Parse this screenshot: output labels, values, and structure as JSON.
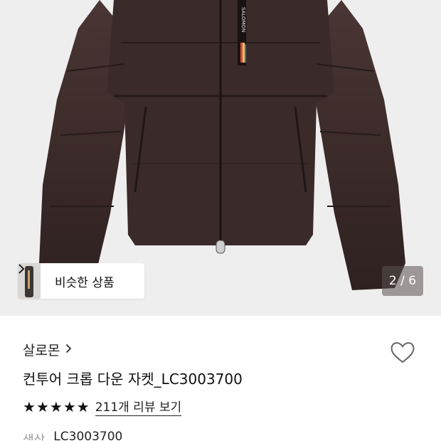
{
  "product_image": {
    "similar_label": "비슷한 상품",
    "pager": "2 / 6",
    "jacket_color": "#3a2a29"
  },
  "brand": {
    "name": "살로몬"
  },
  "product": {
    "title": "컨투어 크롭 다운 자켓_LC3003700",
    "rating_stars": 5,
    "review_link": "211개 리뷰 보기",
    "color_label": "색상",
    "color_value": "LC3003700"
  },
  "icons": {
    "similar_chevron": "chevron-right-icon",
    "brand_chevron": "chevron-right-icon",
    "wishlist": "heart-icon",
    "star": "star-icon"
  }
}
